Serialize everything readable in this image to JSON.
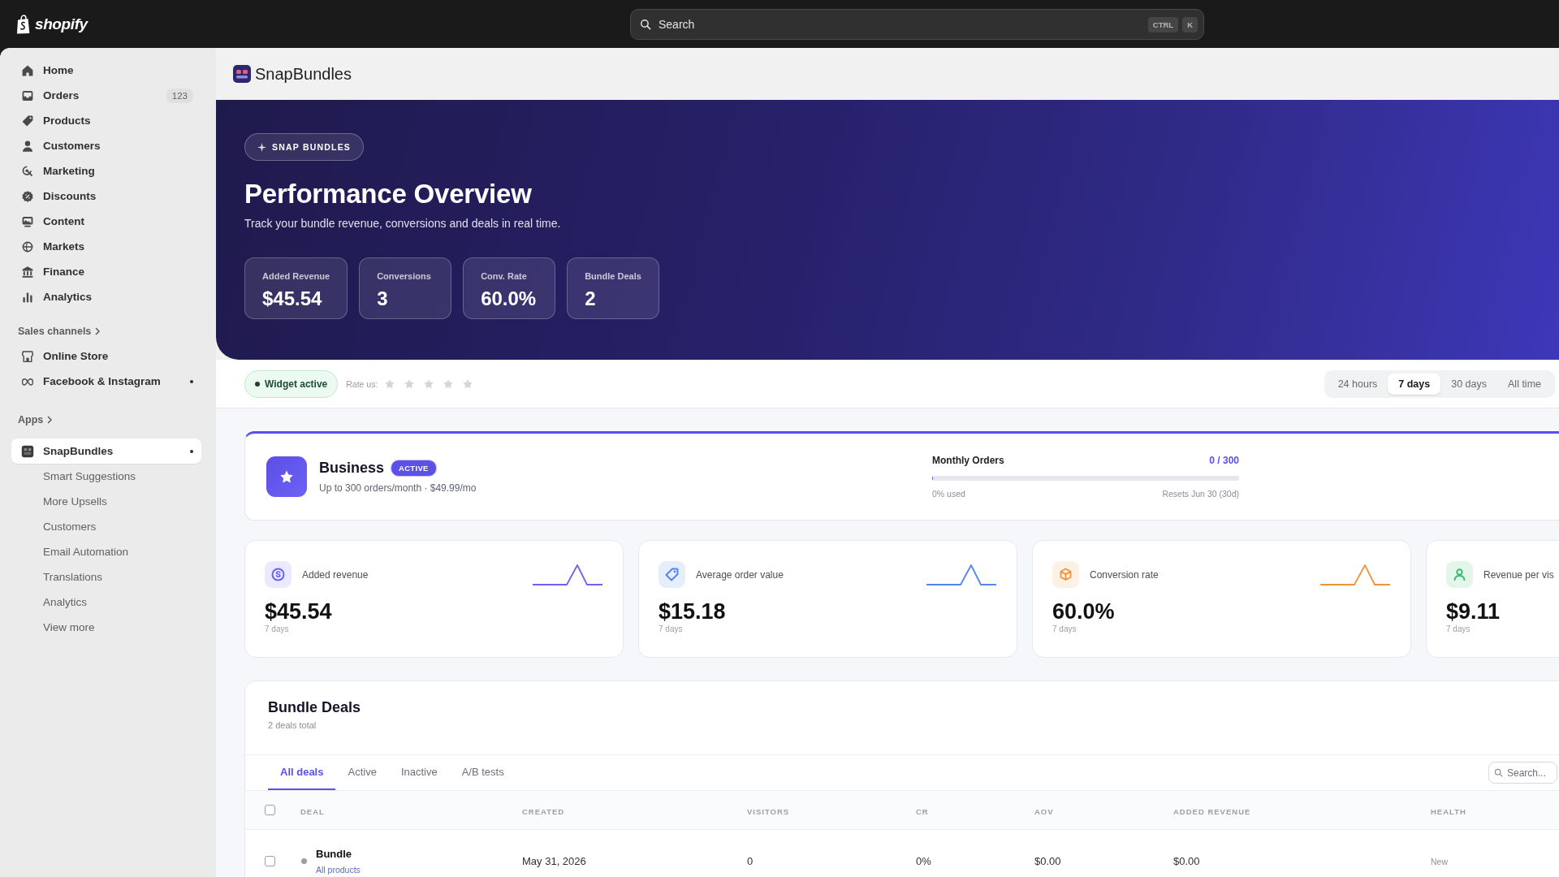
{
  "top_bar": {
    "logo_text": "shopify",
    "search": {
      "placeholder": "Search",
      "shortcut": [
        "CTRL",
        "K"
      ]
    }
  },
  "sidebar": {
    "items": [
      {
        "label": "Home",
        "selected": false
      },
      {
        "label": "Orders",
        "badge": "123",
        "selected": false
      },
      {
        "label": "Products",
        "selected": false
      },
      {
        "label": "Customers",
        "selected": false
      },
      {
        "label": "Marketing",
        "selected": false
      },
      {
        "label": "Discounts",
        "selected": false
      },
      {
        "label": "Content",
        "selected": false
      },
      {
        "label": "Markets",
        "selected": false
      },
      {
        "label": "Finance",
        "selected": false
      },
      {
        "label": "Analytics",
        "selected": false
      }
    ],
    "sections": [
      {
        "title": "Sales channels",
        "items": [
          {
            "label": "Online Store",
            "selected": false,
            "indicator": false
          },
          {
            "label": "Facebook & Instagram",
            "selected": false,
            "indicator": true
          }
        ]
      },
      {
        "title": "Apps",
        "items": [
          {
            "label": "SnapBundles",
            "selected": true,
            "indicator": true,
            "children": [
              {
                "label": "Smart Suggestions",
                "selected": false
              },
              {
                "label": "More Upsells",
                "selected": false
              },
              {
                "label": "Customers",
                "selected": false
              },
              {
                "label": "Email Automation",
                "selected": false
              },
              {
                "label": "Translations",
                "selected": false
              },
              {
                "label": "Analytics",
                "selected": false
              },
              {
                "label": "View more",
                "selected": false
              }
            ]
          }
        ]
      }
    ]
  },
  "page_header": {
    "title": "SnapBundles"
  },
  "hero": {
    "tag": "SNAP BUNDLES",
    "title": "Performance Overview",
    "subtitle": "Track your bundle revenue, conversions and deals in real time.",
    "stats": [
      {
        "label": "Added Revenue",
        "value": "$45.54"
      },
      {
        "label": "Conversions",
        "value": "3"
      },
      {
        "label": "Conv. Rate",
        "value": "60.0%"
      },
      {
        "label": "Bundle Deals",
        "value": "2"
      }
    ]
  },
  "toolbar": {
    "widget_status": {
      "label": "Widget active",
      "active": true
    },
    "rating": {
      "label": "Rate us:",
      "stars": 0
    },
    "ranges": [
      {
        "label": "24 hours",
        "selected": false
      },
      {
        "label": "7 days",
        "selected": true
      },
      {
        "label": "30 days",
        "selected": false
      },
      {
        "label": "All time",
        "selected": false
      }
    ]
  },
  "plan": {
    "name": "Business",
    "badge": "ACTIVE",
    "description": "Up to 300 orders/month · $49.99/mo",
    "usage": {
      "label": "Monthly Orders",
      "reading": "0 / 300",
      "level": 0,
      "used": "0% used",
      "reset": "Resets Jun 30 (30d)"
    }
  },
  "metrics": [
    {
      "label": "Added revenue",
      "value": "$45.54",
      "period": "7 days",
      "color": "#6b63f0",
      "sparkline": true
    },
    {
      "label": "Average order value",
      "value": "$15.18",
      "period": "7 days",
      "color": "#4f86ef",
      "sparkline": true
    },
    {
      "label": "Conversion rate",
      "value": "60.0%",
      "period": "7 days",
      "color": "#f0943c",
      "sparkline": true
    },
    {
      "label": "Revenue per vis",
      "value": "$9.11",
      "period": "7 days",
      "color": "#3dbb73",
      "sparkline": false
    }
  ],
  "deals": {
    "title": "Bundle Deals",
    "subtitle": "2 deals total",
    "tabs": [
      {
        "label": "All deals",
        "selected": true
      },
      {
        "label": "Active",
        "selected": false
      },
      {
        "label": "Inactive",
        "selected": false
      },
      {
        "label": "A/B tests",
        "selected": false
      }
    ],
    "search": {
      "placeholder": "Search..."
    },
    "table": {
      "select_all": {
        "checked": false
      },
      "columns": [
        "DEAL",
        "CREATED",
        "VISITORS",
        "CR",
        "AOV",
        "ADDED REVENUE",
        "HEALTH"
      ],
      "rows": [
        {
          "checked": false,
          "color": "#9e9e9e",
          "scope": "All products",
          "cells": [
            "Bundle",
            "May 31, 2026",
            "0",
            "0%",
            "$0.00",
            "$0.00",
            "New"
          ]
        }
      ]
    }
  }
}
